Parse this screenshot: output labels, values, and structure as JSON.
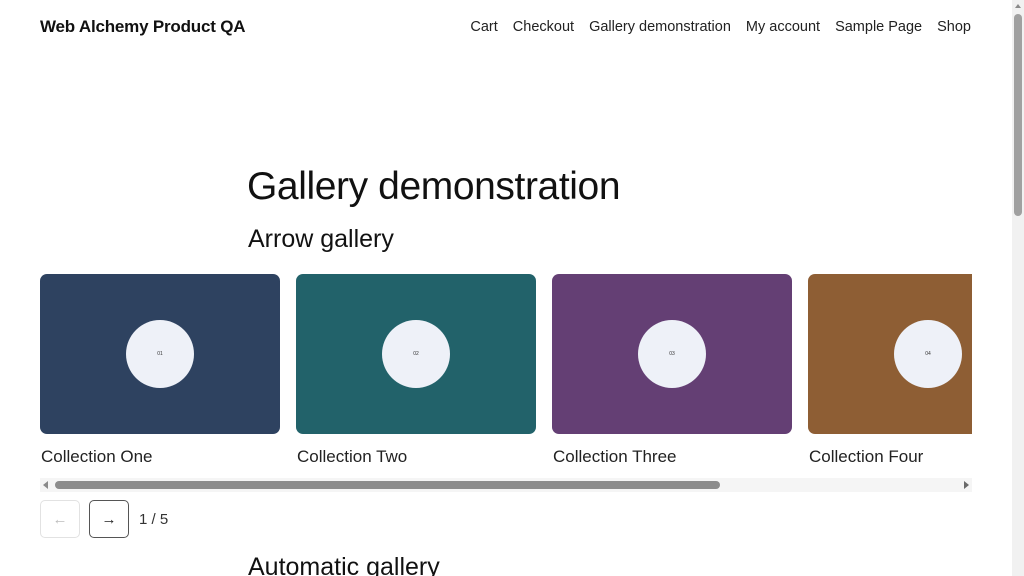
{
  "header": {
    "site_title": "Web Alchemy Product QA",
    "nav": [
      "Cart",
      "Checkout",
      "Gallery demonstration",
      "My account",
      "Sample Page",
      "Shop"
    ]
  },
  "main": {
    "page_title": "Gallery demonstration",
    "arrow_gallery": {
      "heading": "Arrow gallery",
      "slides": [
        {
          "number": "01",
          "caption": "Collection One",
          "color": "#2e4260"
        },
        {
          "number": "02",
          "caption": "Collection Two",
          "color": "#22626a"
        },
        {
          "number": "03",
          "caption": "Collection Three",
          "color": "#643f74"
        },
        {
          "number": "04",
          "caption": "Collection Four",
          "color": "#8e5e34"
        }
      ],
      "prev_icon": "arrow-left-icon",
      "next_icon": "arrow-right-icon",
      "prev_glyph": "←",
      "next_glyph": "→",
      "pager": "1 / 5"
    },
    "automatic_gallery": {
      "heading": "Automatic gallery"
    }
  },
  "colors": {
    "circle": "#eef1f8",
    "scroll_thumb": "#8c8c8c"
  }
}
